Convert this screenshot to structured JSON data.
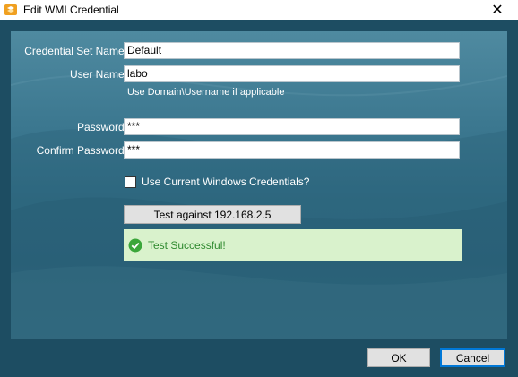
{
  "window": {
    "title": "Edit WMI Credential",
    "close_symbol": "✕"
  },
  "form": {
    "credential_set_name": {
      "label": "Credential Set Name:",
      "value": "Default"
    },
    "user_name": {
      "label": "User Name:",
      "value": "labo",
      "hint": "Use Domain\\Username if applicable"
    },
    "password": {
      "label": "Password:",
      "value": "***"
    },
    "confirm_password": {
      "label": "Confirm Password:",
      "value": "***"
    },
    "use_current": {
      "label": "Use Current Windows Credentials?",
      "checked": false
    }
  },
  "test": {
    "button_label": "Test against 192.168.2.5",
    "result_text": "Test Successful!",
    "result_color": "#2f8a2f"
  },
  "footer": {
    "ok_label": "OK",
    "cancel_label": "Cancel"
  },
  "colors": {
    "panel_bg": "#1d4d62",
    "success_bg": "#d9f2cc",
    "accent": "#0078d7"
  },
  "icons": {
    "app": "app-icon",
    "success": "check-circle-icon",
    "close": "close-icon"
  }
}
